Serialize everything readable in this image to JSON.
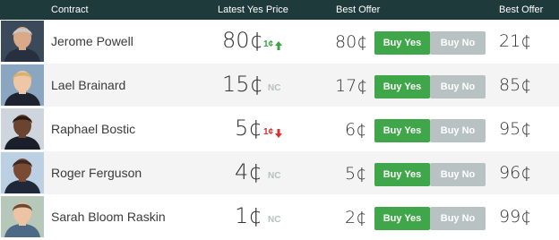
{
  "header": {
    "contract": "Contract",
    "latest_yes_price": "Latest Yes Price",
    "best_offer_yes": "Best Offer",
    "best_offer_no": "Best Offer"
  },
  "buttons": {
    "buy_yes": "Buy Yes",
    "buy_no": "Buy No"
  },
  "rows": [
    {
      "name": "Jerome Powell",
      "price": "80¢",
      "change": "1¢",
      "change_dir": "up",
      "yes_offer": "80¢",
      "no_offer": "21¢",
      "avatar_skin": "#d9a988",
      "avatar_hair": "#c9c9c9",
      "avatar_bg": "#3b4a5a",
      "avatar_shirt": "#27303f"
    },
    {
      "name": "Lael Brainard",
      "price": "15¢",
      "change": "NC",
      "change_dir": "nc",
      "yes_offer": "17¢",
      "no_offer": "85¢",
      "avatar_skin": "#efc7a6",
      "avatar_hair": "#d7b26b",
      "avatar_bg": "#8aa6c0",
      "avatar_shirt": "#1d2430"
    },
    {
      "name": "Raphael Bostic",
      "price": "5¢",
      "change": "1¢",
      "change_dir": "down",
      "yes_offer": "6¢",
      "no_offer": "95¢",
      "avatar_skin": "#6b4430",
      "avatar_hair": "#2a1c15",
      "avatar_bg": "#cfd5dc",
      "avatar_shirt": "#1a1f2b"
    },
    {
      "name": "Roger Ferguson",
      "price": "4¢",
      "change": "NC",
      "change_dir": "nc",
      "yes_offer": "5¢",
      "no_offer": "96¢",
      "avatar_skin": "#7a4a33",
      "avatar_hair": "#3a2a22",
      "avatar_bg": "#bcd0e4",
      "avatar_shirt": "#1f2838"
    },
    {
      "name": "Sarah Bloom Raskin",
      "price": "1¢",
      "change": "NC",
      "change_dir": "nc",
      "yes_offer": "2¢",
      "no_offer": "99¢",
      "avatar_skin": "#eec3a4",
      "avatar_hair": "#6b4a33",
      "avatar_bg": "#b6c8b9",
      "avatar_shirt": "#4c6a86"
    }
  ]
}
